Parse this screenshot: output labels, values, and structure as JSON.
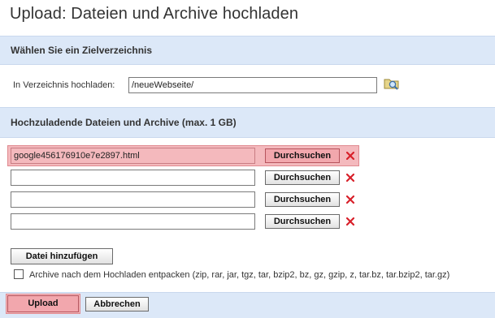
{
  "page": {
    "title": "Upload: Dateien und Archive hochladen"
  },
  "target": {
    "heading": "Wählen Sie ein Zielverzeichnis",
    "label": "In Verzeichnis hochladen:",
    "value": "/neueWebseite/",
    "browse_icon": "folder-search-icon"
  },
  "files": {
    "heading": "Hochzuladende Dateien und Archive (max. 1 GB)",
    "rows": [
      {
        "value": "google456176910e7e2897.html",
        "browse_label": "Durchsuchen",
        "remove_icon": "red-x-icon"
      },
      {
        "value": "",
        "browse_label": "Durchsuchen",
        "remove_icon": "red-x-icon"
      },
      {
        "value": "",
        "browse_label": "Durchsuchen",
        "remove_icon": "red-x-icon"
      },
      {
        "value": "",
        "browse_label": "Durchsuchen",
        "remove_icon": "red-x-icon"
      }
    ],
    "add_label": "Datei hinzufügen",
    "extract_label": "Archive nach dem Hochladen entpacken (zip, rar, jar, tgz, tar, bzip2, bz, gz, gzip, z, tar.bz, tar.bzip2, tar.gz)",
    "extract_checked": false
  },
  "actions": {
    "upload_label": "Upload",
    "cancel_label": "Abbrechen"
  },
  "colors": {
    "band": "#dce8f8",
    "highlight": "#f4b9bd",
    "remove": "#d8202a"
  }
}
